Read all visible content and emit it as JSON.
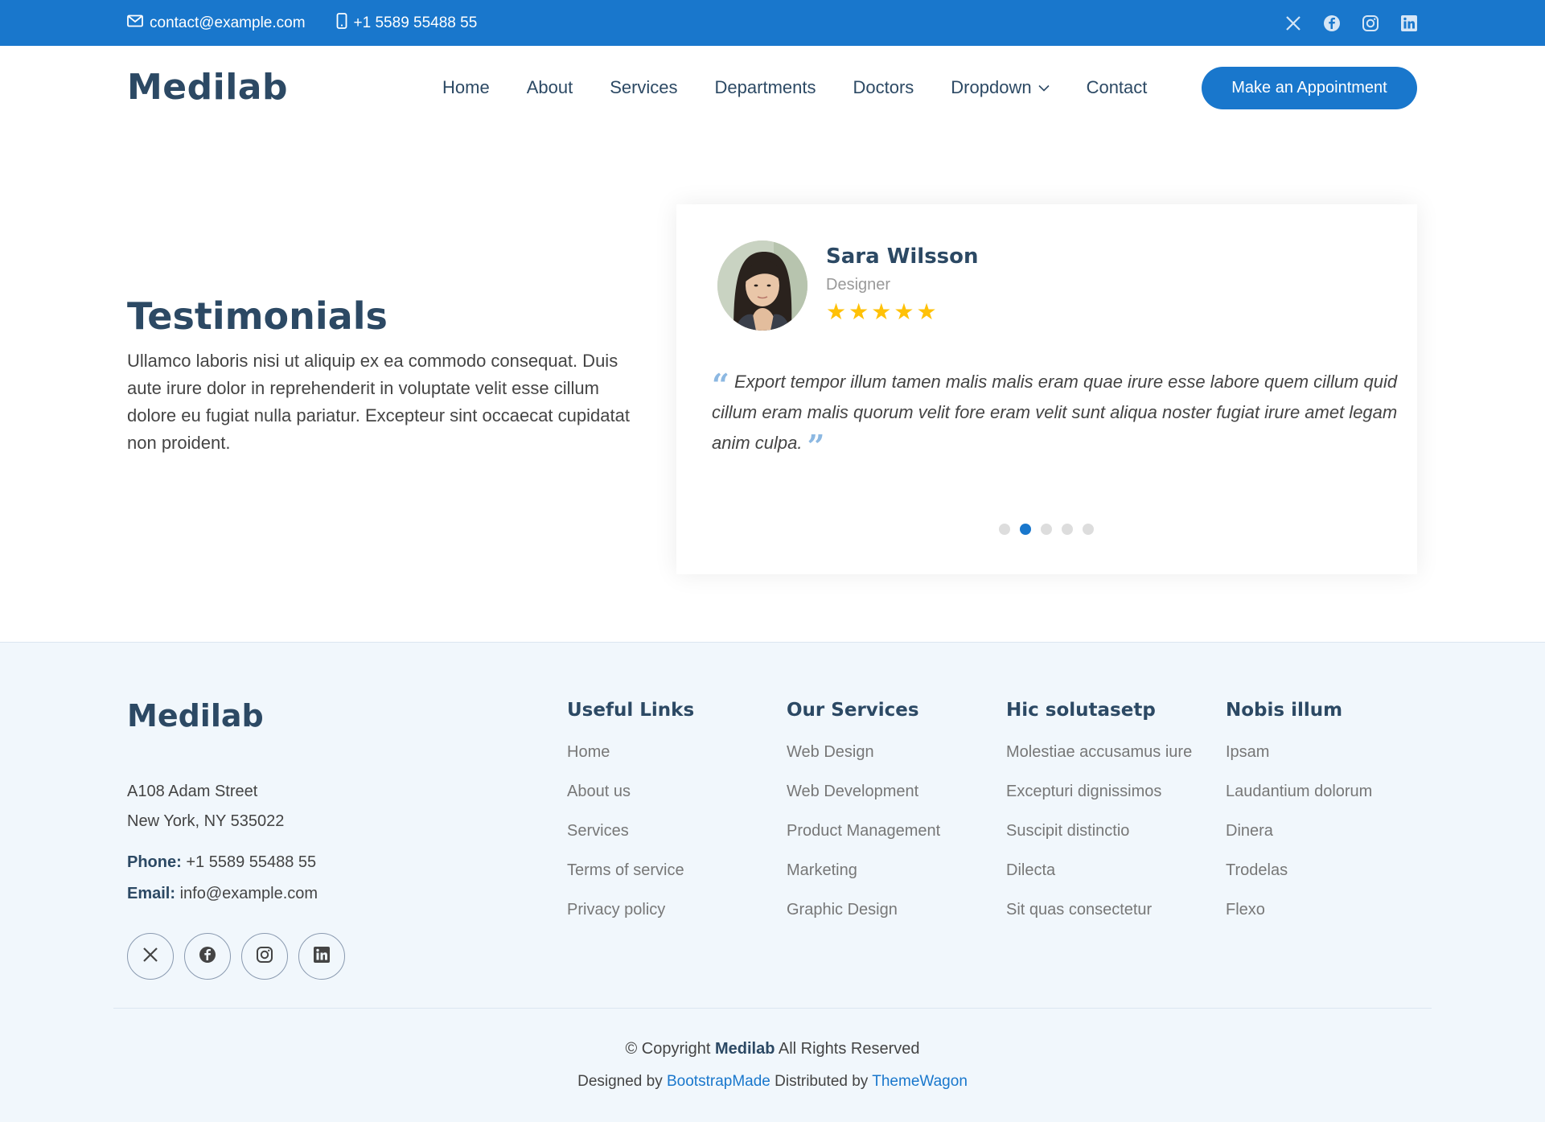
{
  "topbar": {
    "email": "contact@example.com",
    "phone": "+1 5589 55488 55",
    "socials": [
      "x-icon",
      "facebook-icon",
      "instagram-icon",
      "linkedin-icon"
    ]
  },
  "header": {
    "logo": "Medilab",
    "nav": [
      "Home",
      "About",
      "Services",
      "Departments",
      "Doctors",
      "Dropdown",
      "Contact"
    ],
    "cta": "Make an Appointment"
  },
  "testimonials": {
    "title": "Testimonials",
    "description": "Ullamco laboris nisi ut aliquip ex ea commodo consequat. Duis aute irure dolor in reprehenderit in voluptate velit esse cillum dolore eu fugiat nulla pariatur. Excepteur sint occaecat cupidatat non proident.",
    "name": "Sara Wilsson",
    "role": "Designer",
    "rating": 5,
    "quote": "Export tempor illum tamen malis malis eram quae irure esse labore quem cillum quid cillum eram malis quorum velit fore eram velit sunt aliqua noster fugiat irure amet legam anim culpa.",
    "slides": 5,
    "active_slide": 2
  },
  "footer": {
    "logo": "Medilab",
    "address_line1": "A108 Adam Street",
    "address_line2": "New York, NY 535022",
    "phone_label": "Phone:",
    "phone": "+1 5589 55488 55",
    "email_label": "Email:",
    "email": "info@example.com",
    "columns": [
      {
        "title": "Useful Links",
        "links": [
          "Home",
          "About us",
          "Services",
          "Terms of service",
          "Privacy policy"
        ]
      },
      {
        "title": "Our Services",
        "links": [
          "Web Design",
          "Web Development",
          "Product Management",
          "Marketing",
          "Graphic Design"
        ]
      },
      {
        "title": "Hic solutasetp",
        "links": [
          "Molestiae accusamus iure",
          "Excepturi dignissimos",
          "Suscipit distinctio",
          "Dilecta",
          "Sit quas consectetur"
        ]
      },
      {
        "title": "Nobis illum",
        "links": [
          "Ipsam",
          "Laudantium dolorum",
          "Dinera",
          "Trodelas",
          "Flexo"
        ]
      }
    ],
    "copyright_prefix": "© Copyright",
    "copyright_brand": "Medilab",
    "copyright_suffix": "All Rights Reserved",
    "designed_by_label": "Designed by",
    "designed_by": "BootstrapMade",
    "distributed_by_label": "Distributed by",
    "distributed_by": "ThemeWagon"
  },
  "colors": {
    "accent": "#1977cc",
    "heading": "#2c4964",
    "footer_bg": "#f1f7fc",
    "star": "#ffc107"
  }
}
